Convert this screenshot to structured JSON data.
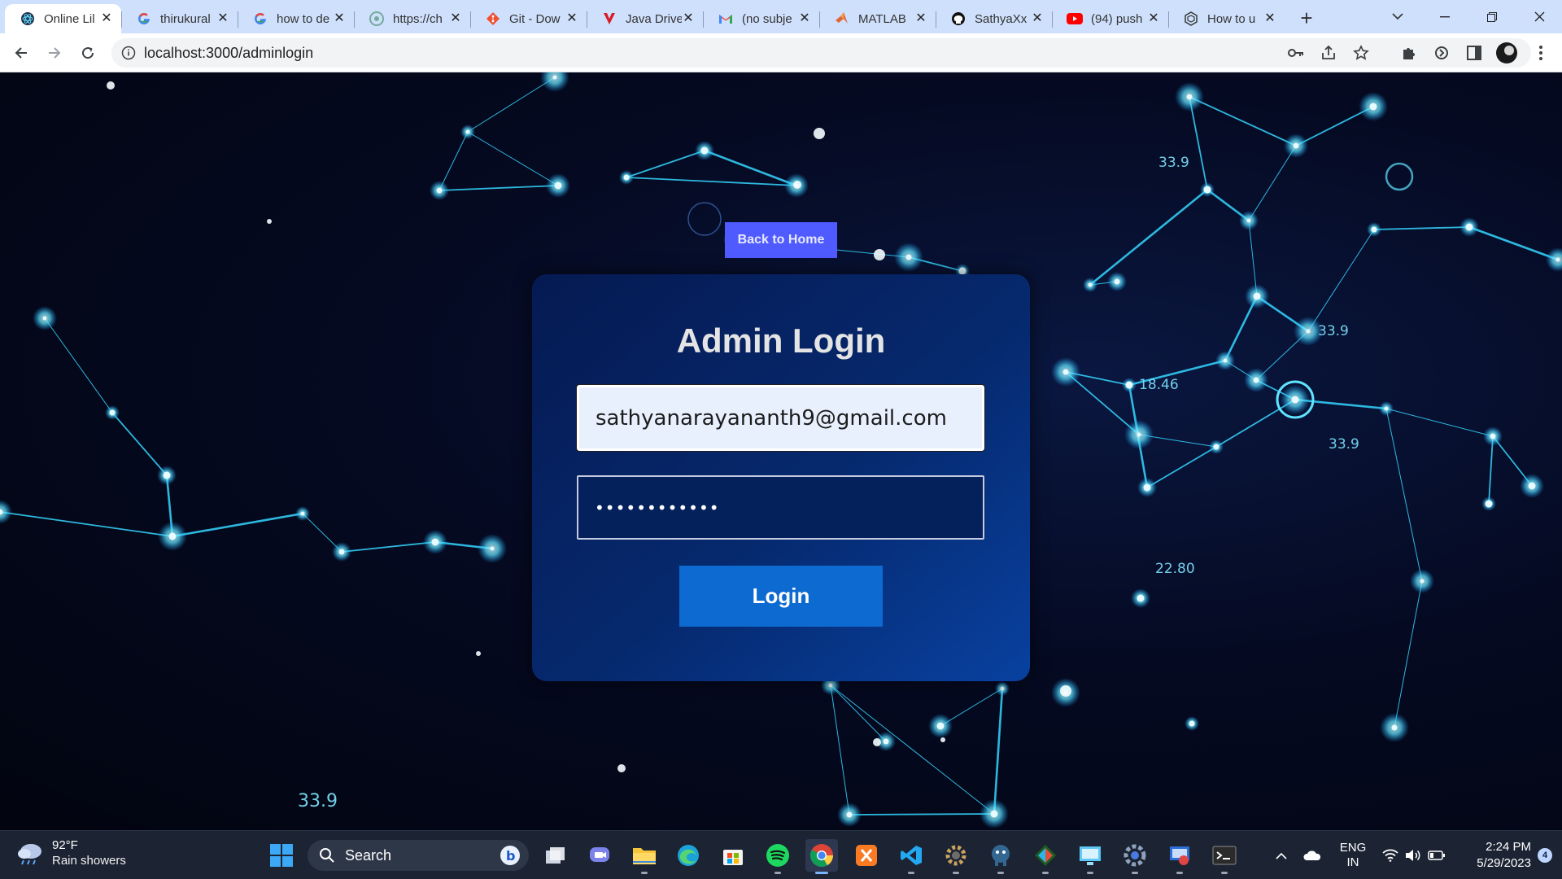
{
  "browser": {
    "tabs": [
      {
        "title": "Online Lil",
        "icon": "react-icon",
        "active": true
      },
      {
        "title": "thirukural",
        "icon": "google-icon"
      },
      {
        "title": "how to de",
        "icon": "google-icon"
      },
      {
        "title": "https://ch",
        "icon": "chatgpt-icon"
      },
      {
        "title": "Git - Dow",
        "icon": "git-icon"
      },
      {
        "title": "Java Drive",
        "icon": "vertx-icon"
      },
      {
        "title": "(no subje",
        "icon": "gmail-icon"
      },
      {
        "title": "MATLAB",
        "icon": "matlab-icon"
      },
      {
        "title": "SathyaXx",
        "icon": "github-icon"
      },
      {
        "title": "(94) push",
        "icon": "youtube-icon"
      },
      {
        "title": "How to u",
        "icon": "openai-icon"
      }
    ],
    "new_tab_label": "+",
    "url": "localhost:3000/adminlogin"
  },
  "page": {
    "back_home_label": "Back to Home",
    "title": "Admin Login",
    "email_value": "sathyanarayananth9@gmail.com",
    "password_mask": "••••••••••••",
    "login_label": "Login",
    "background_numbers": [
      "33.9",
      "33.9",
      "18.46",
      "33.9",
      "22.80",
      "33.9"
    ]
  },
  "taskbar": {
    "weather_temp": "92°F",
    "weather_desc": "Rain showers",
    "search_label": "Search",
    "lang_line1": "ENG",
    "lang_line2": "IN",
    "time": "2:24 PM",
    "date": "5/29/2023",
    "notification_count": "4"
  },
  "colors": {
    "accent": "#4f5bff",
    "card": "#06296e",
    "login_button": "#0c6ad0",
    "network_lines": "#35d6ff"
  }
}
